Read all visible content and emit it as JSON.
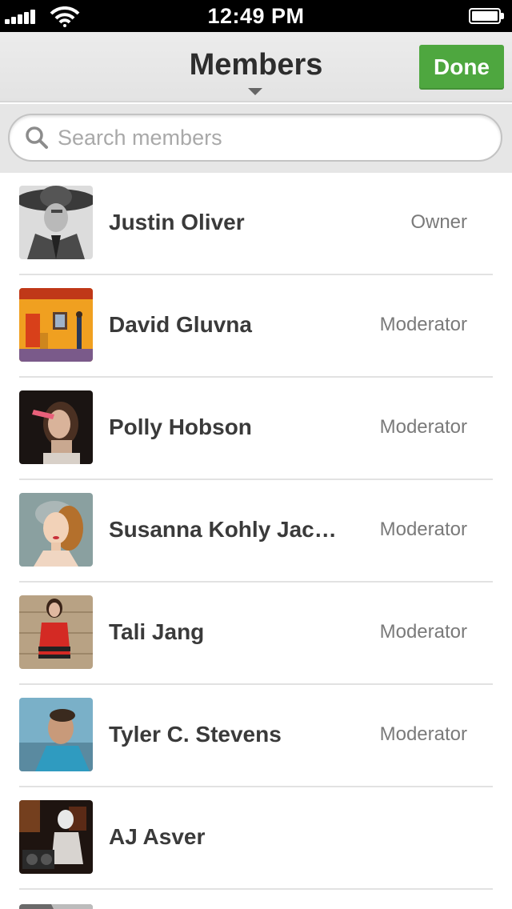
{
  "status_bar": {
    "time": "12:49 PM",
    "icons": [
      "signal-bars-icon",
      "wifi-icon",
      "battery-icon"
    ]
  },
  "nav": {
    "title": "Members",
    "done_label": "Done"
  },
  "search": {
    "placeholder": "Search members"
  },
  "members": [
    {
      "name": "Justin Oliver",
      "role": "Owner"
    },
    {
      "name": "David Gluvna",
      "role": "Moderator"
    },
    {
      "name": "Polly Hobson",
      "role": "Moderator"
    },
    {
      "name": "Susanna Kohly Jaco…",
      "role": "Moderator"
    },
    {
      "name": "Tali Jang",
      "role": "Moderator"
    },
    {
      "name": "Tyler C. Stevens",
      "role": "Moderator"
    },
    {
      "name": "AJ Asver",
      "role": ""
    }
  ],
  "colors": {
    "accent_green": "#4ea73f",
    "nav_background": "#e8e8e8",
    "text_dark": "#3a3a3a",
    "text_muted": "#7a7a7a"
  }
}
